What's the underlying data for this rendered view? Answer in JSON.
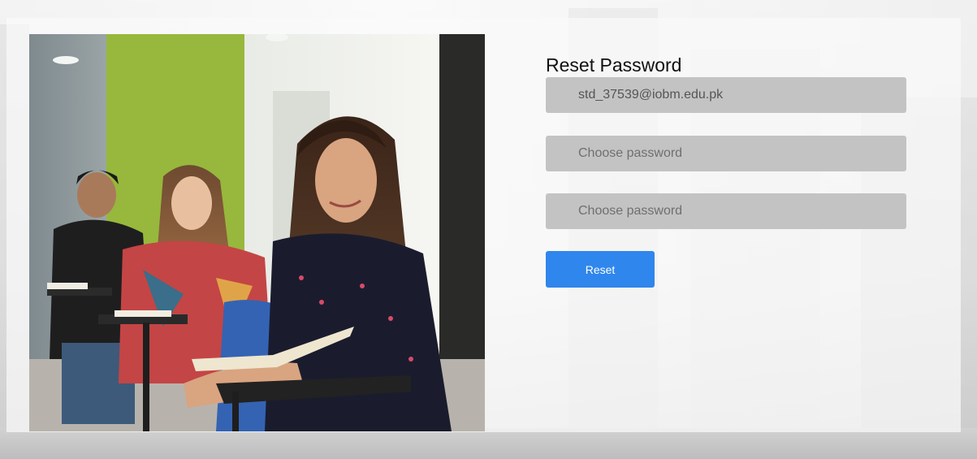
{
  "form": {
    "title": "Reset Password",
    "email_value": "std_37539@iobm.edu.pk",
    "password_placeholder": "Choose password",
    "confirm_placeholder": "Choose password",
    "reset_label": "Reset"
  },
  "colors": {
    "accent": "#2f86ec",
    "field_bg": "#c3c3c3"
  }
}
